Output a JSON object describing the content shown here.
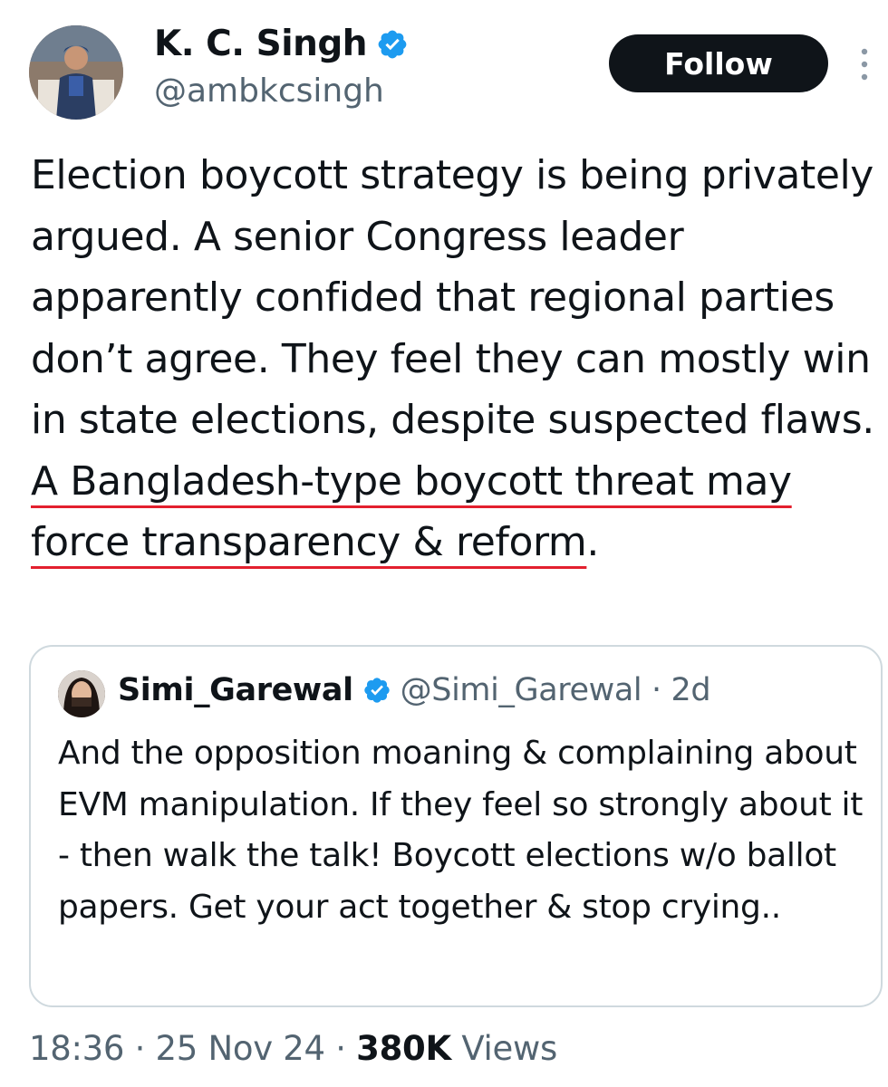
{
  "author": {
    "display_name": "K. C. Singh",
    "handle": "@ambkcsingh",
    "avatar_icon": "profile-photo",
    "verified_icon": "verified-badge-icon"
  },
  "actions": {
    "follow_label": "Follow",
    "more_icon": "more-vertical-icon"
  },
  "tweet": {
    "text_plain": "Election boycott strategy is being privately argued. A senior Congress leader apparently confided that regional parties don’t agree. They feel they can mostly win in state elections, despite suspected flaws. ",
    "text_underlined": "A Bangladesh-type boycott threat may force transparency & reform",
    "text_end": "."
  },
  "quoted_tweet": {
    "display_name": "Simi_Garewal",
    "handle": "@Simi_Garewal",
    "separator": "·",
    "age": "2d",
    "text": "And the opposition moaning & complaining about EVM manipulation. If they feel so strongly about it - then walk the talk! Boycott elections w/o ballot papers. Get your act together & stop crying.."
  },
  "footer": {
    "time": "18:36",
    "sep1": "·",
    "date": "25 Nov 24",
    "sep2": "·",
    "views_count": "380K",
    "views_label": "Views"
  },
  "colors": {
    "verified": "#1d9bf0",
    "underline": "#e3202e",
    "secondary_text": "#536471",
    "follow_bg": "#0f1419"
  }
}
